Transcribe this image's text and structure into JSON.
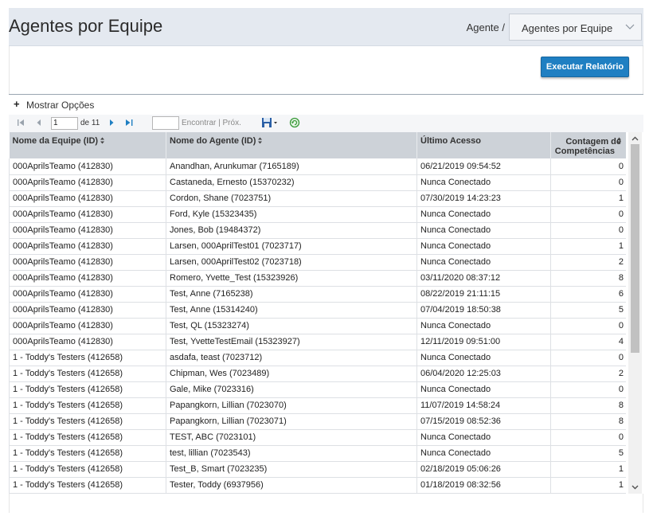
{
  "header": {
    "title": "Agentes por Equipe",
    "breadcrumb_label": "Agente /",
    "report_select": "Agentes por Equipe"
  },
  "actions": {
    "run_report": "Executar Relatório"
  },
  "options": {
    "toggle_symbol": "+",
    "label": "Mostrar Opções"
  },
  "toolbar": {
    "page_value": "1",
    "page_of": "de 11",
    "find_label": "Encontrar | Próx."
  },
  "table": {
    "columns": [
      "Nome da Equipe (ID)",
      "Nome do Agente (ID)",
      "Último Acesso",
      "Contagem de Competências"
    ],
    "rows": [
      [
        "000AprilsTeamo (412830)",
        "Anandhan, Arunkumar (7165189)",
        "06/21/2019 09:54:52",
        "0"
      ],
      [
        "000AprilsTeamo (412830)",
        "Castaneda, Ernesto (15370232)",
        "Nunca Conectado",
        "0"
      ],
      [
        "000AprilsTeamo (412830)",
        "Cordon, Shane (7023751)",
        "07/30/2019 14:23:23",
        "1"
      ],
      [
        "000AprilsTeamo (412830)",
        "Ford, Kyle (15323435)",
        "Nunca Conectado",
        "0"
      ],
      [
        "000AprilsTeamo (412830)",
        "Jones, Bob (19484372)",
        "Nunca Conectado",
        "0"
      ],
      [
        "000AprilsTeamo (412830)",
        "Larsen, 000AprilTest01 (7023717)",
        "Nunca Conectado",
        "1"
      ],
      [
        "000AprilsTeamo (412830)",
        "Larsen, 000AprilTest02 (7023718)",
        "Nunca Conectado",
        "2"
      ],
      [
        "000AprilsTeamo (412830)",
        "Romero, Yvette_Test (15323926)",
        "03/11/2020 08:37:12",
        "8"
      ],
      [
        "000AprilsTeamo (412830)",
        "Test, Anne (7165238)",
        "08/22/2019 21:11:15",
        "6"
      ],
      [
        "000AprilsTeamo (412830)",
        "Test, Anne (15314240)",
        "07/04/2019 18:50:38",
        "5"
      ],
      [
        "000AprilsTeamo (412830)",
        "Test, QL (15323274)",
        "Nunca Conectado",
        "0"
      ],
      [
        "000AprilsTeamo (412830)",
        "Test, YvetteTestEmail (15323927)",
        "12/11/2019 09:51:00",
        "4"
      ],
      [
        "1 - Toddy's Testers (412658)",
        "asdafa, teast (7023712)",
        "Nunca Conectado",
        "0"
      ],
      [
        "1 - Toddy's Testers (412658)",
        "Chipman, Wes (7023489)",
        "06/04/2020 12:25:03",
        "2"
      ],
      [
        "1 - Toddy's Testers (412658)",
        "Gale, Mike (7023316)",
        "Nunca Conectado",
        "0"
      ],
      [
        "1 - Toddy's Testers (412658)",
        "Papangkorn, Lillian (7023070)",
        "11/07/2019 14:58:24",
        "8"
      ],
      [
        "1 - Toddy's Testers (412658)",
        "Papangkorn, Lillian (7023071)",
        "07/15/2019 08:52:36",
        "8"
      ],
      [
        "1 - Toddy's Testers (412658)",
        "TEST, ABC (7023101)",
        "Nunca Conectado",
        "0"
      ],
      [
        "1 - Toddy's Testers (412658)",
        "test, lillian (7023543)",
        "Nunca Conectado",
        "5"
      ],
      [
        "1 - Toddy's Testers (412658)",
        "Test_B, Smart (7023235)",
        "02/18/2019 05:06:26",
        "1"
      ],
      [
        "1 - Toddy's Testers (412658)",
        "Tester, Toddy (6937956)",
        "01/18/2019 08:32:56",
        "1"
      ]
    ]
  },
  "colors": {
    "primary_button": "#1f7fc2",
    "header_band": "#e4e9f0",
    "table_header": "#cdd2d8",
    "toolbar_nav_icon": "#1f7fc2",
    "refresh_icon": "#3a9a3a"
  },
  "icons": {
    "first_page": "first-page-icon",
    "prev_page": "prev-page-icon",
    "next_page": "next-page-icon",
    "last_page": "last-page-icon",
    "export": "save-export-icon",
    "refresh": "refresh-icon",
    "sort": "sort-icon"
  }
}
